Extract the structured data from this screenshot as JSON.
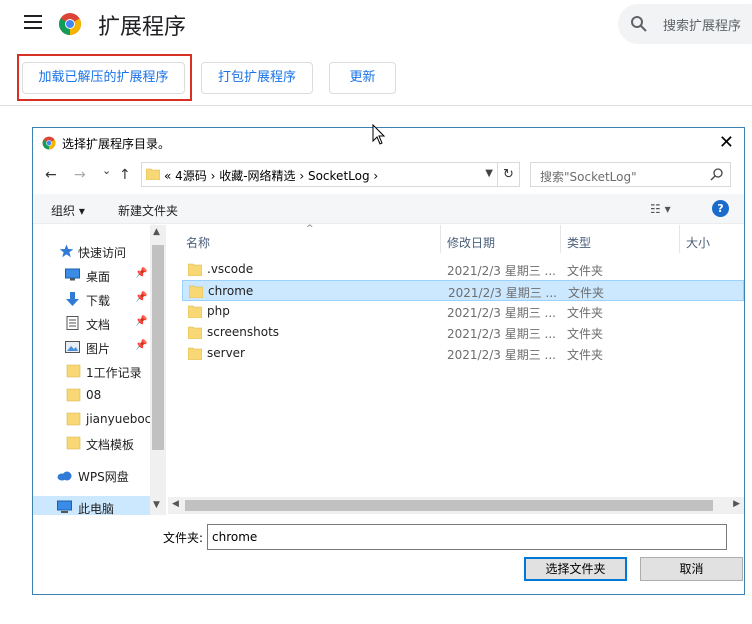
{
  "page": {
    "title": "扩展程序",
    "search_placeholder": "搜索扩展程序",
    "buttons": {
      "load_unpacked": "加载已解压的扩展程序",
      "pack": "打包扩展程序",
      "update": "更新"
    }
  },
  "dialog": {
    "title": "选择扩展程序目录。",
    "close_glyph": "✕",
    "nav": {
      "back": "←",
      "forward": "→",
      "recent": "⌄",
      "up": "↑"
    },
    "breadcrumb": "«  4源码  ›  收藏-网络精选  ›  SocketLog  ›",
    "search_placeholder": "搜索\"SocketLog\"",
    "toolbar": {
      "organize": "组织 ▾",
      "new_folder": "新建文件夹",
      "view": "☷ ▾",
      "help": "?"
    },
    "nav_pane": [
      {
        "label": "快速访问",
        "icon": "star-icon",
        "pinned": false,
        "selected": false
      },
      {
        "label": "桌面",
        "icon": "desktop-icon",
        "pinned": true,
        "selected": false
      },
      {
        "label": "下载",
        "icon": "download-icon",
        "pinned": true,
        "selected": false
      },
      {
        "label": "文档",
        "icon": "document-icon",
        "pinned": true,
        "selected": false
      },
      {
        "label": "图片",
        "icon": "picture-icon",
        "pinned": true,
        "selected": false
      },
      {
        "label": "1工作记录",
        "icon": "folder-icon",
        "pinned": false,
        "selected": false
      },
      {
        "label": "08",
        "icon": "folder-icon",
        "pinned": false,
        "selected": false
      },
      {
        "label": "jianyueboc",
        "icon": "folder-icon",
        "pinned": false,
        "selected": false
      },
      {
        "label": "文档模板",
        "icon": "folder-icon",
        "pinned": false,
        "selected": false
      },
      {
        "label": "WPS网盘",
        "icon": "cloud-icon",
        "pinned": false,
        "selected": false
      },
      {
        "label": "此电脑",
        "icon": "computer-icon",
        "pinned": false,
        "selected": true
      }
    ],
    "columns": {
      "name": "名称",
      "date": "修改日期",
      "type": "类型",
      "size": "大小"
    },
    "files": [
      {
        "name": ".vscode",
        "date": "2021/2/3 星期三 ...",
        "type": "文件夹",
        "selected": false
      },
      {
        "name": "chrome",
        "date": "2021/2/3 星期三 ...",
        "type": "文件夹",
        "selected": true
      },
      {
        "name": "php",
        "date": "2021/2/3 星期三 ...",
        "type": "文件夹",
        "selected": false
      },
      {
        "name": "screenshots",
        "date": "2021/2/3 星期三 ...",
        "type": "文件夹",
        "selected": false
      },
      {
        "name": "server",
        "date": "2021/2/3 星期三 ...",
        "type": "文件夹",
        "selected": false
      }
    ],
    "folder_label": "文件夹:",
    "folder_value": "chrome",
    "select_button": "选择文件夹",
    "cancel_button": "取消"
  },
  "colors": {
    "chrome_blue": "#1a73e8",
    "highlight_red": "#d93025",
    "selection_bg": "#cce8ff",
    "folder_yellow": "#f8d775",
    "dialog_border": "#3c7fb1"
  }
}
